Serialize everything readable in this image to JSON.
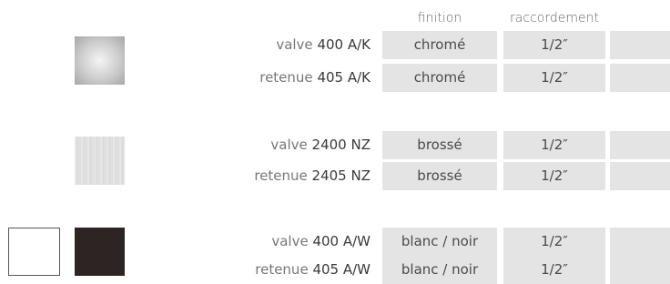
{
  "headers": {
    "finition": "finition",
    "raccordement": "raccordement"
  },
  "groups": [
    {
      "swatches": [
        "chrome-swatch"
      ],
      "rows": [
        {
          "kind": "valve",
          "code": "400 A/K",
          "finition": "chromé",
          "raccordement": "1/2″"
        },
        {
          "kind": "retenue",
          "code": "405 A/K",
          "finition": "chromé",
          "raccordement": "1/2″"
        }
      ]
    },
    {
      "swatches": [
        "brushed-swatch"
      ],
      "rows": [
        {
          "kind": "valve",
          "code": "2400 NZ",
          "finition": "brossé",
          "raccordement": "1/2″"
        },
        {
          "kind": "retenue",
          "code": "2405 NZ",
          "finition": "brossé",
          "raccordement": "1/2″"
        }
      ]
    },
    {
      "swatches": [
        "white-swatch",
        "black-swatch"
      ],
      "rows": [
        {
          "kind": "valve",
          "code": "400 A/W",
          "finition": "blanc / noir",
          "raccordement": "1/2″"
        },
        {
          "kind": "retenue",
          "code": "405 A/W",
          "finition": "blanc / noir",
          "raccordement": "1/2″"
        }
      ]
    }
  ],
  "colors": {
    "cell_background": "#e4e4e4",
    "black_finish": "#2c2524"
  }
}
